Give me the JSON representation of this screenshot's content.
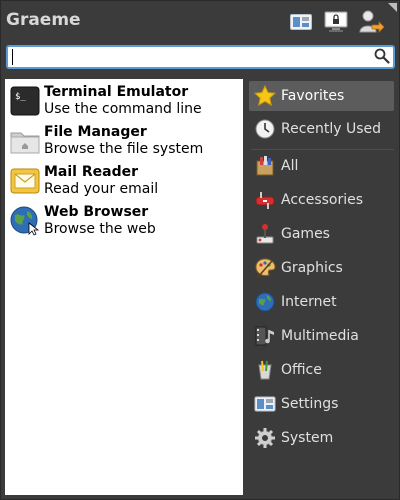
{
  "header": {
    "user_name": "Graeme",
    "buttons": [
      {
        "name": "settings-manager-button",
        "icon": "settings-icon"
      },
      {
        "name": "lock-screen-button",
        "icon": "lock-screen-icon"
      },
      {
        "name": "log-out-button",
        "icon": "log-out-icon"
      }
    ]
  },
  "search": {
    "value": "",
    "placeholder": ""
  },
  "apps": [
    {
      "title": "Terminal Emulator",
      "description": "Use the command line",
      "icon": "terminal-icon"
    },
    {
      "title": "File Manager",
      "description": "Browse the file system",
      "icon": "folder-icon"
    },
    {
      "title": "Mail Reader",
      "description": "Read your email",
      "icon": "mail-icon"
    },
    {
      "title": "Web Browser",
      "description": "Browse the web",
      "icon": "globe-icon"
    }
  ],
  "categories": [
    {
      "label": "Favorites",
      "icon": "star-icon",
      "active": true
    },
    {
      "label": "Recently Used",
      "icon": "clock-icon"
    },
    {
      "label": "All",
      "icon": "all-apps-icon"
    },
    {
      "label": "Accessories",
      "icon": "accessories-icon"
    },
    {
      "label": "Games",
      "icon": "joystick-icon"
    },
    {
      "label": "Graphics",
      "icon": "palette-icon"
    },
    {
      "label": "Internet",
      "icon": "globe-icon"
    },
    {
      "label": "Multimedia",
      "icon": "multimedia-icon"
    },
    {
      "label": "Office",
      "icon": "office-icon"
    },
    {
      "label": "Settings",
      "icon": "settings-icon"
    },
    {
      "label": "System",
      "icon": "gear-icon"
    }
  ],
  "colors": {
    "accent": "#5b9bd5",
    "panel": "#3b3b3b",
    "active_category": "#5c5c5c"
  }
}
